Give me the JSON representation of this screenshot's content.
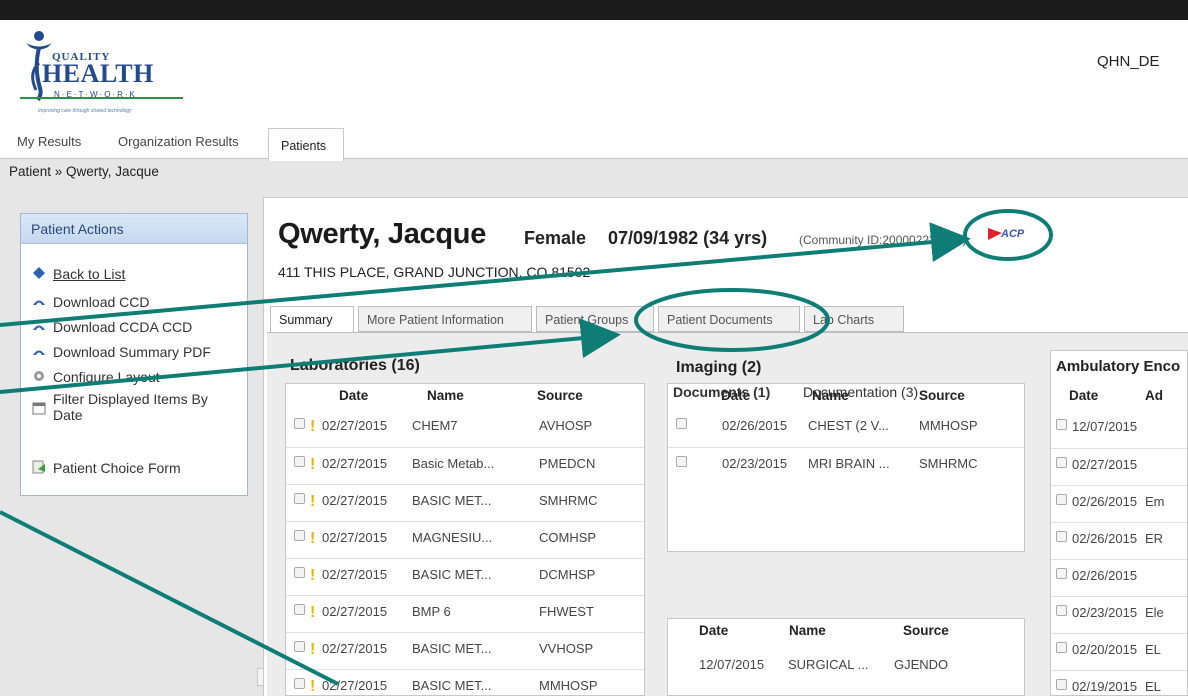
{
  "header": {
    "logo": {
      "top": "QUALITY",
      "main": "HEALTH",
      "sub": "N·E·T·W·O·R·K",
      "tagline": "Improving care through shared technology"
    },
    "user": "QHN_DE"
  },
  "nav": {
    "my_results": "My Results",
    "org_results": "Organization Results",
    "patients": "Patients"
  },
  "breadcrumb": "Patient » Qwerty, Jacque",
  "actions": {
    "title": "Patient Actions",
    "items": [
      {
        "label": "Back to List",
        "icon": "back-diamond-icon"
      },
      {
        "label": "Download CCD",
        "icon": "download-icon"
      },
      {
        "label": "Download CCDA CCD",
        "icon": "download-icon"
      },
      {
        "label": "Download Summary PDF",
        "icon": "download-icon"
      },
      {
        "label": "Configure Layout",
        "icon": "gear-icon"
      },
      {
        "label": "Filter Displayed Items By Date",
        "icon": "calendar-icon"
      },
      {
        "label": "Patient Choice Form",
        "icon": "form-icon"
      }
    ]
  },
  "patient": {
    "name": "Qwerty, Jacque",
    "gender": "Female",
    "dob": "07/09/1982 (34 yrs)",
    "community_id": "(Community ID:200002222202)",
    "address": "411 THIS PLACE, GRAND JUNCTION, CO 81502",
    "flag": "ACP"
  },
  "tabs": [
    "Summary",
    "More Patient Information",
    "Patient Groups",
    "Patient Documents",
    "Lab Charts"
  ],
  "labs": {
    "title": "Laboratories (16)",
    "headers": [
      "Date",
      "Name",
      "Source"
    ],
    "rows": [
      [
        "02/27/2015",
        "CHEM7",
        "AVHOSP"
      ],
      [
        "02/27/2015",
        "Basic Metab...",
        "PMEDCN"
      ],
      [
        "02/27/2015",
        "BASIC MET...",
        "SMHRMC"
      ],
      [
        "02/27/2015",
        "MAGNESIU...",
        "COMHSP"
      ],
      [
        "02/27/2015",
        "BASIC MET...",
        "DCMHSP"
      ],
      [
        "02/27/2015",
        "BMP 6",
        "FHWEST"
      ],
      [
        "02/27/2015",
        "BASIC MET...",
        "VVHOSP"
      ],
      [
        "02/27/2015",
        "BASIC MET...",
        "MMHOSP"
      ]
    ]
  },
  "imaging": {
    "title": "Imaging (2)",
    "headers": [
      "Date",
      "Name",
      "Source"
    ],
    "rows": [
      [
        "02/26/2015",
        "CHEST (2 V...",
        "MMHOSP"
      ],
      [
        "02/23/2015",
        "MRI BRAIN ...",
        "SMHRMC"
      ]
    ]
  },
  "documents": {
    "tab1": "Documents (1)",
    "tab2": "Documentation (3)",
    "headers": [
      "Date",
      "Name",
      "Source"
    ],
    "rows": [
      [
        "12/07/2015",
        "SURGICAL ...",
        "GJENDO"
      ]
    ]
  },
  "ambulatory": {
    "title": "Ambulatory Enco",
    "headers": [
      "Date",
      "Ad"
    ],
    "rows": [
      [
        "12/07/2015",
        ""
      ],
      [
        "02/27/2015",
        ""
      ],
      [
        "02/26/2015",
        "Em"
      ],
      [
        "02/26/2015",
        "ER"
      ],
      [
        "02/26/2015",
        ""
      ],
      [
        "02/23/2015",
        "Ele"
      ],
      [
        "02/20/2015",
        "EL"
      ],
      [
        "02/19/2015",
        "EL"
      ]
    ]
  },
  "colors": {
    "annotation": "#0e7d76",
    "accent": "#234a8c",
    "flag": "#e0202a"
  }
}
